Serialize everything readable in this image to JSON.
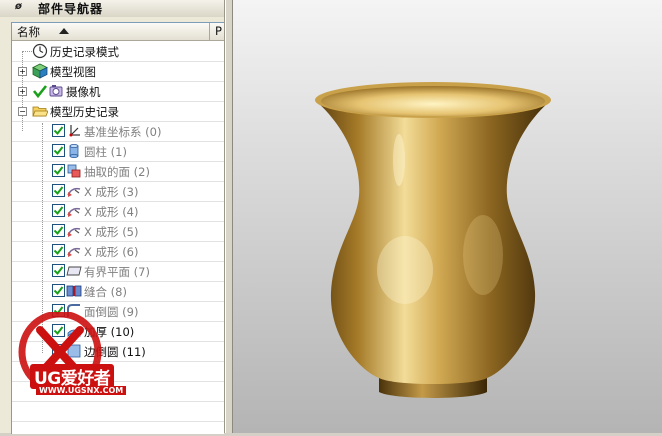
{
  "navigator": {
    "title": "部件导航器",
    "pin_glyph": "ø",
    "column_name": "名称",
    "column_p": "P",
    "rows": [
      {
        "label": "历史记录模式",
        "icon": "clock-icon",
        "grey": false
      },
      {
        "label": "模型视图",
        "icon": "cube-view-icon",
        "grey": false
      },
      {
        "label": "摄像机",
        "icon": "camera-icon",
        "grey": false
      },
      {
        "label": "模型历史记录",
        "icon": "folder-open-icon",
        "grey": false
      },
      {
        "label": "基准坐标系 (0)",
        "icon": "datum-csys-icon",
        "grey": true
      },
      {
        "label": "圆柱 (1)",
        "icon": "cylinder-icon",
        "grey": true
      },
      {
        "label": "抽取的面 (2)",
        "icon": "extract-face-icon",
        "grey": true
      },
      {
        "label": "X 成形 (3)",
        "icon": "x-form-icon",
        "grey": true
      },
      {
        "label": "X 成形 (4)",
        "icon": "x-form-icon",
        "grey": true
      },
      {
        "label": "X 成形 (5)",
        "icon": "x-form-icon",
        "grey": true
      },
      {
        "label": "X 成形 (6)",
        "icon": "x-form-icon",
        "grey": true
      },
      {
        "label": "有界平面 (7)",
        "icon": "bounded-plane-icon",
        "grey": true
      },
      {
        "label": "缝合 (8)",
        "icon": "sew-icon",
        "grey": true
      },
      {
        "label": "面倒圆 (9)",
        "icon": "face-blend-icon",
        "grey": true
      },
      {
        "label": "加厚 (10)",
        "icon": "thicken-icon",
        "grey": false
      },
      {
        "label": "边倒圆 (11)",
        "icon": "edge-blend-icon",
        "grey": false
      }
    ]
  },
  "watermark": {
    "text": "UG爱好者",
    "url": "WWW.UGSNX.COM"
  },
  "colors": {
    "vase_gold": "#c8a040",
    "watermark_red": "#cc1010",
    "check_green": "#1aa01a"
  }
}
